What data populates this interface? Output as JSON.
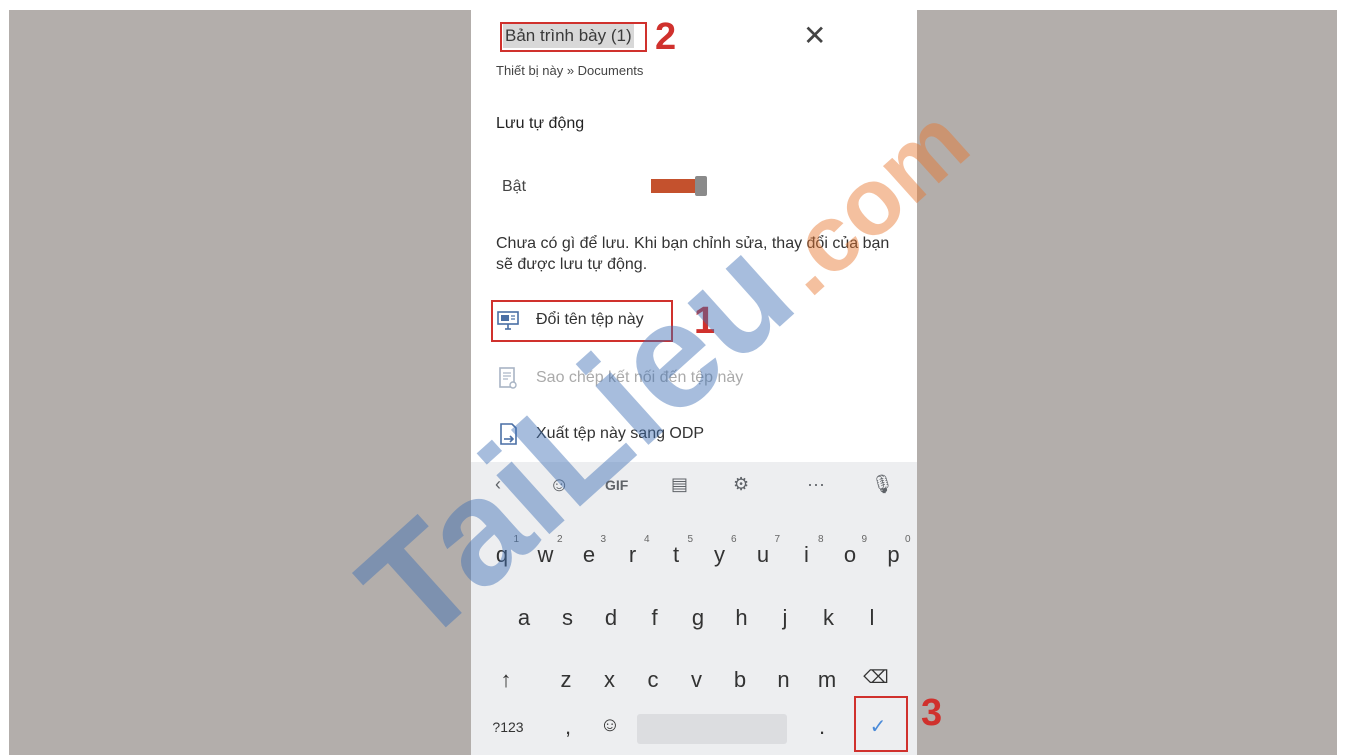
{
  "header": {
    "filename": "Bản trình bày (1)",
    "path": "Thiết bị này » Documents"
  },
  "autosave": {
    "section_title": "Lưu tự động",
    "toggle_label": "Bật",
    "toggle_on": true,
    "info_text": "Chưa có gì để lưu. Khi bạn chỉnh sửa, thay đổi của bạn sẽ được lưu tự động."
  },
  "menu": {
    "rename": "Đổi tên tệp này",
    "copy_link": "Sao chép kết nối đến tệp này",
    "export": "Xuất tệp này sang ODP"
  },
  "annotations": {
    "one": "1",
    "two": "2",
    "three": "3"
  },
  "keyboard": {
    "toolbar_gif": "GIF",
    "toolbar_more": "···",
    "row1": [
      "q",
      "w",
      "e",
      "r",
      "t",
      "y",
      "u",
      "i",
      "o",
      "p"
    ],
    "row1_hints": [
      "1",
      "2",
      "3",
      "4",
      "5",
      "6",
      "7",
      "8",
      "9",
      "0"
    ],
    "row2": [
      "a",
      "s",
      "d",
      "f",
      "g",
      "h",
      "j",
      "k",
      "l"
    ],
    "row3": [
      "z",
      "x",
      "c",
      "v",
      "b",
      "n",
      "m"
    ],
    "symbols": "?123",
    "comma": ",",
    "period": "."
  },
  "colors": {
    "accent_red": "#d0312d",
    "toggle_track": "#c4512d",
    "watermark_blue": "#3d6fb5",
    "watermark_orange": "#e8752d"
  },
  "watermark": {
    "brand": "TaiLieu",
    "suffix": ".com"
  }
}
